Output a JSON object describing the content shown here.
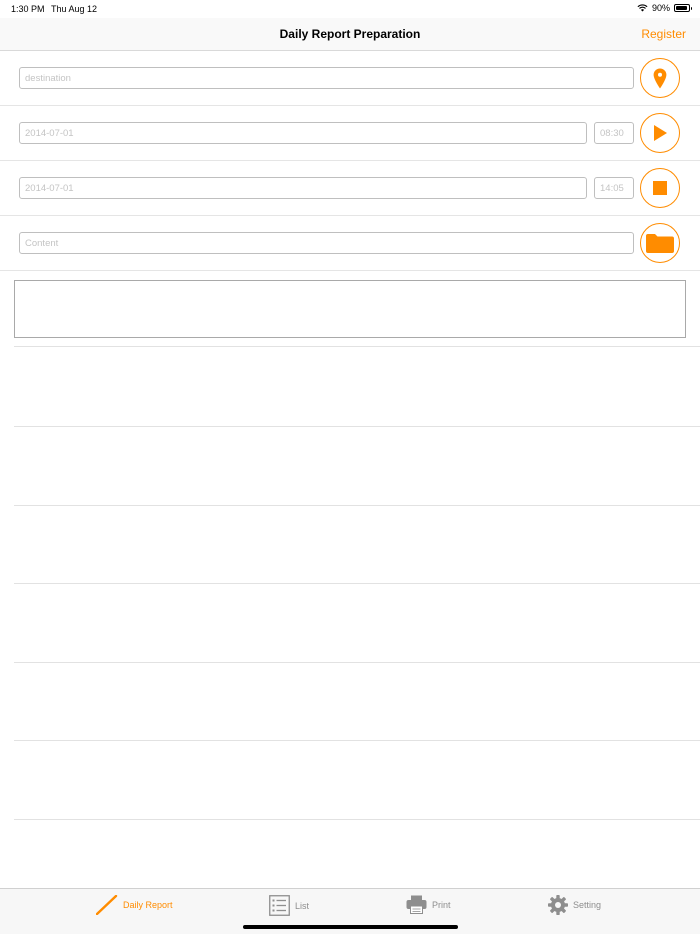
{
  "status_bar": {
    "time": "1:30 PM",
    "date": "Thu Aug 12",
    "battery": "90%",
    "battery_level": 0.9
  },
  "nav": {
    "title": "Daily Report Preparation",
    "register": "Register"
  },
  "form": {
    "destination_placeholder": "destination",
    "start_date": "2014-07-01",
    "start_time": "08:30",
    "end_date": "2014-07-01",
    "end_time": "14:05",
    "content_placeholder": "Content"
  },
  "icons": {
    "destination": "location-pin-icon",
    "start": "play-icon",
    "stop": "stop-icon",
    "content": "folder-icon",
    "wifi": "wifi-icon",
    "battery": "battery-icon"
  },
  "colors": {
    "accent": "#ff8c00",
    "inactive_tab": "#8e8e8e"
  },
  "tabs": [
    {
      "label": "Daily Report",
      "icon": "pencil-icon",
      "active": true
    },
    {
      "label": "List",
      "icon": "list-icon",
      "active": false
    },
    {
      "label": "Print",
      "icon": "printer-icon",
      "active": false
    },
    {
      "label": "Setting",
      "icon": "gear-icon",
      "active": false
    }
  ]
}
